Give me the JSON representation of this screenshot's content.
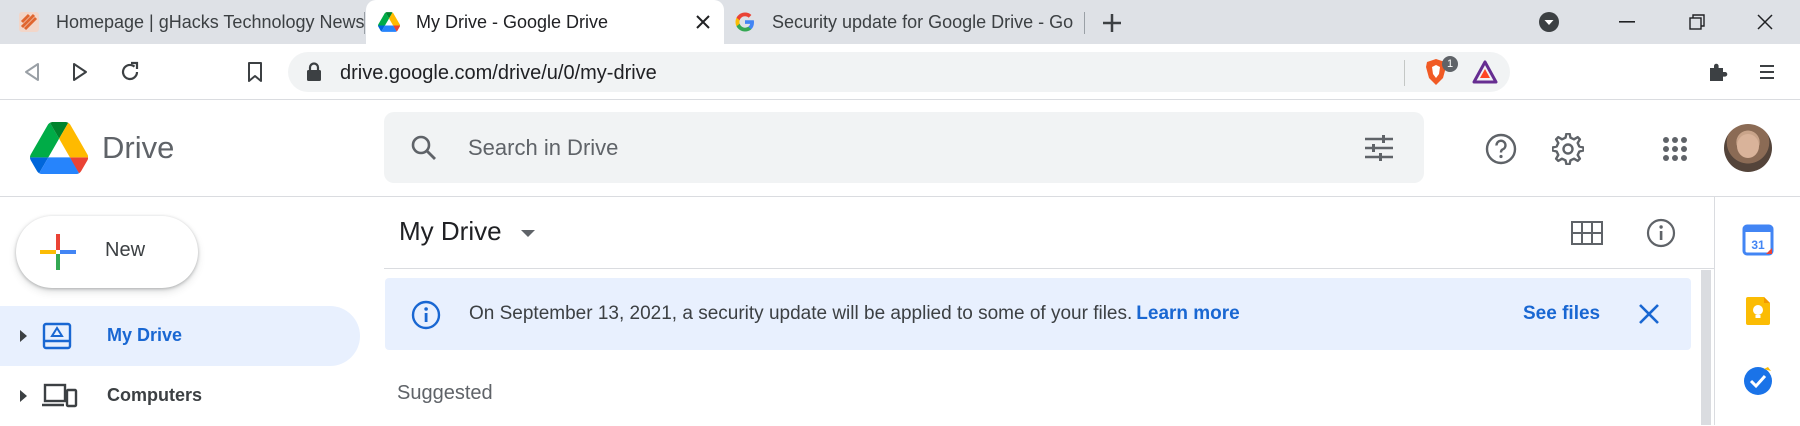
{
  "browser": {
    "tabs": [
      {
        "title": "Homepage | gHacks Technology News",
        "active": false
      },
      {
        "title": "My Drive - Google Drive",
        "active": true
      },
      {
        "title": "Security update for Google Drive - Go",
        "active": false
      }
    ],
    "url": "drive.google.com/drive/u/0/my-drive",
    "extension_badge": "1"
  },
  "header": {
    "product_name": "Drive",
    "search_placeholder": "Search in Drive"
  },
  "sidebar": {
    "new_label": "New",
    "items": [
      {
        "label": "My Drive",
        "active": true
      },
      {
        "label": "Computers",
        "active": false
      }
    ]
  },
  "main": {
    "title": "My Drive",
    "banner": {
      "message": "On September 13, 2021, a security update will be applied to some of your files.",
      "link": "Learn more",
      "action": "See files"
    },
    "section_label": "Suggested"
  },
  "side_panel": {
    "calendar_day": "31"
  },
  "colors": {
    "accent_blue": "#1967d2",
    "banner_bg": "#e8f0fe",
    "tabstrip_bg": "#dee1e6"
  }
}
